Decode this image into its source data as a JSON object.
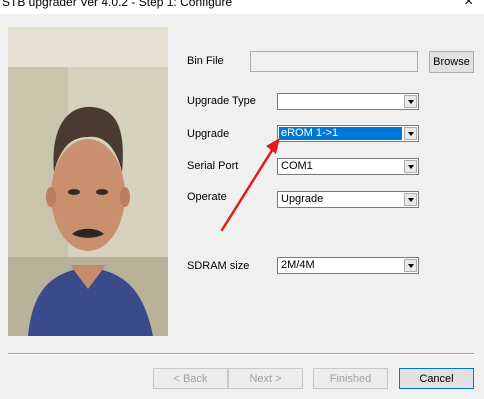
{
  "window": {
    "title": "STB upgrader Ver 4.0.2 - Step 1: Configure"
  },
  "form": {
    "bin_file": {
      "label": "Bin File",
      "value": "",
      "browse_label": "Browse"
    },
    "upgrade_type": {
      "label": "Upgrade Type",
      "value": ""
    },
    "upgrade": {
      "label": "Upgrade",
      "value": "eROM  1->1"
    },
    "serial_port": {
      "label": "Serial Port",
      "value": "COM1"
    },
    "operate": {
      "label": "Operate",
      "value": "Upgrade"
    },
    "sdram_size": {
      "label": "SDRAM size",
      "value": "2M/4M"
    }
  },
  "buttons": {
    "back": "< Back",
    "next": "Next >",
    "finished": "Finished",
    "cancel": "Cancel"
  },
  "annotation": {
    "arrow_color": "#e01b1b"
  },
  "colors": {
    "selection": "#0078d7"
  }
}
